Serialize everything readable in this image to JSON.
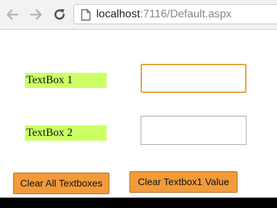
{
  "browser": {
    "back_icon": "back-arrow-icon",
    "forward_icon": "forward-arrow-icon",
    "reload_icon": "reload-icon",
    "page_icon": "page-icon",
    "url_host": "localhost",
    "url_rest": ":7116/Default.aspx"
  },
  "form": {
    "textbox1_label": "TextBox 1",
    "textbox1_value": "",
    "textbox2_label": "TextBox 2",
    "textbox2_value": "",
    "clear_all_button": "Clear All Textboxes",
    "clear_textbox1_button": "Clear Textbox1 Value"
  },
  "colors": {
    "label_background": "#ccff66",
    "button_background": "#f39b3a",
    "focus_border": "#e5a13b"
  }
}
